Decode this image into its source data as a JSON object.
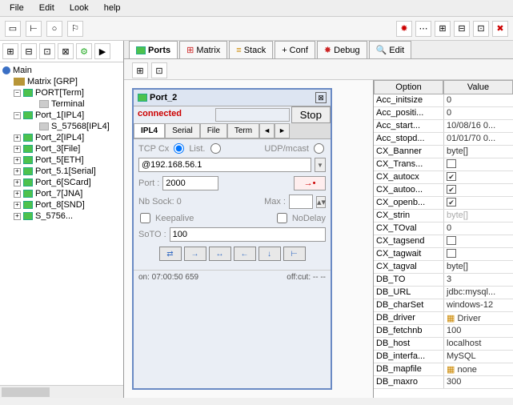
{
  "menu": {
    "file": "File",
    "edit": "Edit",
    "look": "Look",
    "help": "help"
  },
  "tree": {
    "root": "Main",
    "matrix": "Matrix [GRP]",
    "port_term": "PORT[Term]",
    "terminal": "Terminal",
    "port_1": "Port_1[IPL4]",
    "s_57568": "S_57568[IPL4]",
    "port_2": "Port_2[IPL4]",
    "port_3": "Port_3[File]",
    "port_5": "Port_5[ETH]",
    "port_51": "Port_5.1[Serial]",
    "port_6": "Port_6[SCard]",
    "port_7": "Port_7[JNA]",
    "port_8": "Port_8[SND]",
    "s_5756": "S_5756..."
  },
  "tabs": {
    "ports": "Ports",
    "matrix": "Matrix",
    "stack": "Stack",
    "conf": "Conf",
    "debug": "Debug",
    "edit": "Edit"
  },
  "dlg": {
    "title": "Port_2",
    "status": "connected",
    "stop": "Stop",
    "t_ipl4": "IPL4",
    "t_serial": "Serial",
    "t_file": "File",
    "t_term": "Term",
    "tcpcx": "TCP Cx",
    "list": "List.",
    "udp": "UDP/mcast",
    "ip": "@192.168.56.1",
    "port_lbl": "Port :",
    "port_val": "2000",
    "nbsock": "Nb Sock: 0",
    "max": "Max :",
    "keepalive": "Keepalive",
    "nodelay": "NoDelay",
    "soto": "SoTO :",
    "soto_val": "100",
    "foot_on": "on: 07:00:50 659",
    "foot_off": "off:cut: -- --"
  },
  "props": {
    "hd_option": "Option",
    "hd_value": "Value",
    "rows": [
      {
        "k": "Acc_initsize",
        "v": "0"
      },
      {
        "k": "Acc_positi...",
        "v": "0"
      },
      {
        "k": "Acc_start...",
        "v": "10/08/16 0..."
      },
      {
        "k": "Acc_stopd...",
        "v": "01/01/70 0..."
      },
      {
        "k": "CX_Banner",
        "v": "byte[]"
      },
      {
        "k": "CX_Trans...",
        "cb": false
      },
      {
        "k": "CX_autocx",
        "cb": true
      },
      {
        "k": "CX_autoo...",
        "cb": true
      },
      {
        "k": "CX_openb...",
        "cb": true
      },
      {
        "k": "CX_strin",
        "v": "byte[]",
        "gray": true
      },
      {
        "k": "CX_TOval",
        "v": "0"
      },
      {
        "k": "CX_tagsend",
        "cb": false
      },
      {
        "k": "CX_tagwait",
        "cb": false
      },
      {
        "k": "CX_tagval",
        "v": "byte[]"
      },
      {
        "k": "DB_TO",
        "v": "3"
      },
      {
        "k": "DB_URL",
        "v": "jdbc:mysql..."
      },
      {
        "k": "DB_charSet",
        "v": "windows-12"
      },
      {
        "k": "DB_driver",
        "v": "Driver",
        "icon": true
      },
      {
        "k": "DB_fetchnb",
        "v": "100"
      },
      {
        "k": "DB_host",
        "v": "localhost"
      },
      {
        "k": "DB_interfa...",
        "v": "MySQL"
      },
      {
        "k": "DB_mapfile",
        "v": "  none",
        "icon": true
      },
      {
        "k": "DB_maxro",
        "v": "300"
      }
    ]
  }
}
